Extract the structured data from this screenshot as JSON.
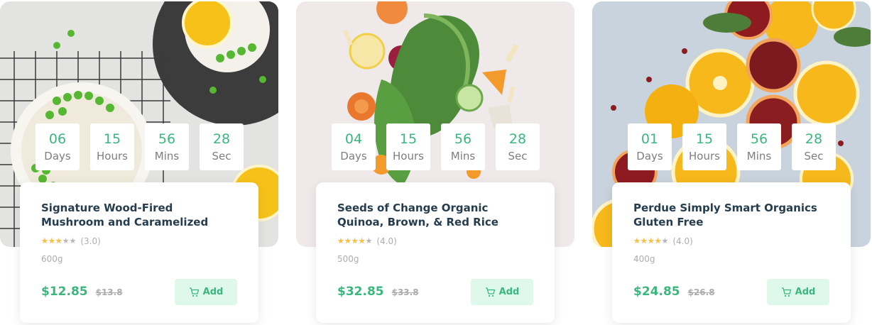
{
  "products": [
    {
      "image_desc_icon": "vegetables-image",
      "countdown": [
        {
          "value": "04",
          "label": "Days"
        },
        {
          "value": "15",
          "label": "Hours"
        },
        {
          "value": "56",
          "label": "Mins"
        },
        {
          "value": "28",
          "label": "Sec"
        }
      ],
      "title": "Seeds of Change Organic Quinoa, Brown, & Red Rice",
      "rating": 4.0,
      "rating_text": "(4.0)",
      "weight": "500g",
      "price": "$32.85",
      "old_price": "$33.8",
      "add_label": "Add"
    },
    {
      "image_desc_icon": "citrus-image",
      "countdown": [
        {
          "value": "01",
          "label": "Days"
        },
        {
          "value": "15",
          "label": "Hours"
        },
        {
          "value": "56",
          "label": "Mins"
        },
        {
          "value": "28",
          "label": "Sec"
        }
      ],
      "title": "Perdue Simply Smart Organics Gluten Free",
      "rating": 4.0,
      "rating_text": "(4.0)",
      "weight": "400g",
      "price": "$24.85",
      "old_price": "$26.8",
      "add_label": "Add"
    },
    {
      "image_desc_icon": "peas-image",
      "countdown": [
        {
          "value": "06",
          "label": "Days"
        },
        {
          "value": "15",
          "label": "Hours"
        },
        {
          "value": "56",
          "label": "Mins"
        },
        {
          "value": "28",
          "label": "Sec"
        }
      ],
      "title": "Signature Wood-Fired Mushroom and Caramelized",
      "rating": 3.0,
      "rating_text": "(3.0)",
      "weight": "600g",
      "price": "$12.85",
      "old_price": "$13.8",
      "add_label": "Add"
    }
  ],
  "colors": {
    "accent": "#3bb77e",
    "accent_light": "#def9ec",
    "title": "#253d4e",
    "muted": "#adadad",
    "star": "#fdc040"
  }
}
